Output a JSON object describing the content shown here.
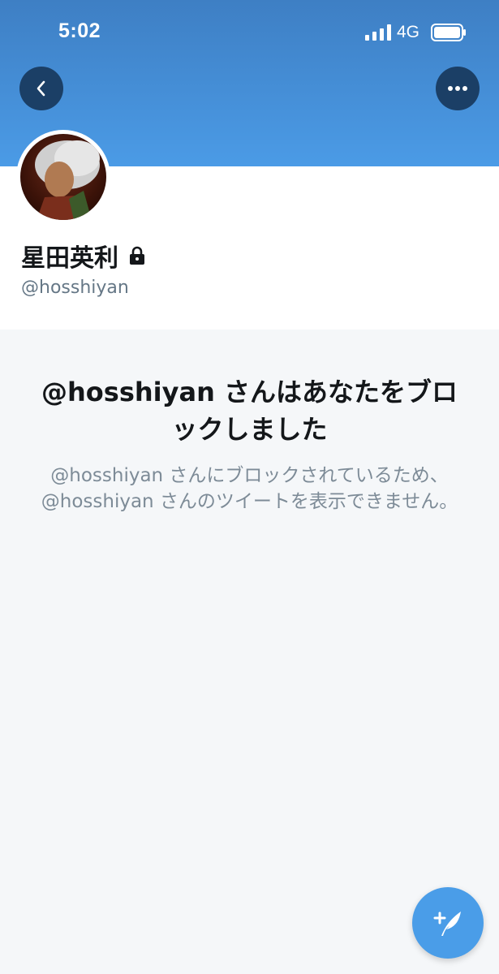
{
  "status_bar": {
    "time": "5:02",
    "network": "4G"
  },
  "profile": {
    "display_name": "星田英利",
    "handle": "@hosshiyan",
    "locked": true
  },
  "blocked": {
    "title": "@hosshiyan さんはあなたをブロックしました",
    "description": "@hosshiyan さんにブロックされているため、@hosshiyan さんのツイートを表示できません。"
  },
  "colors": {
    "banner": "#4b9be6",
    "accent": "#4a9de8",
    "nav_button": "#1b3f66",
    "secondary_text": "#657786"
  },
  "icons": {
    "back": "chevron-left-icon",
    "more": "more-horizontal-icon",
    "lock": "lock-icon",
    "compose": "compose-tweet-icon"
  }
}
